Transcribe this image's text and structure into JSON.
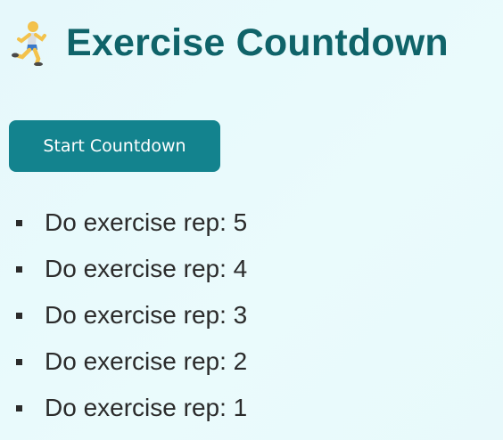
{
  "header": {
    "title": "Exercise Countdown",
    "icon": "runner-icon"
  },
  "controls": {
    "start_label": "Start Countdown"
  },
  "reps": [
    {
      "label": "Do exercise rep: 5"
    },
    {
      "label": "Do exercise rep: 4"
    },
    {
      "label": "Do exercise rep: 3"
    },
    {
      "label": "Do exercise rep: 2"
    },
    {
      "label": "Do exercise rep: 1"
    }
  ],
  "colors": {
    "title": "#0f6369",
    "button_bg": "#13838e",
    "button_text": "#ffffff",
    "text": "#2b2b2b",
    "background": "#e8f9fb"
  }
}
